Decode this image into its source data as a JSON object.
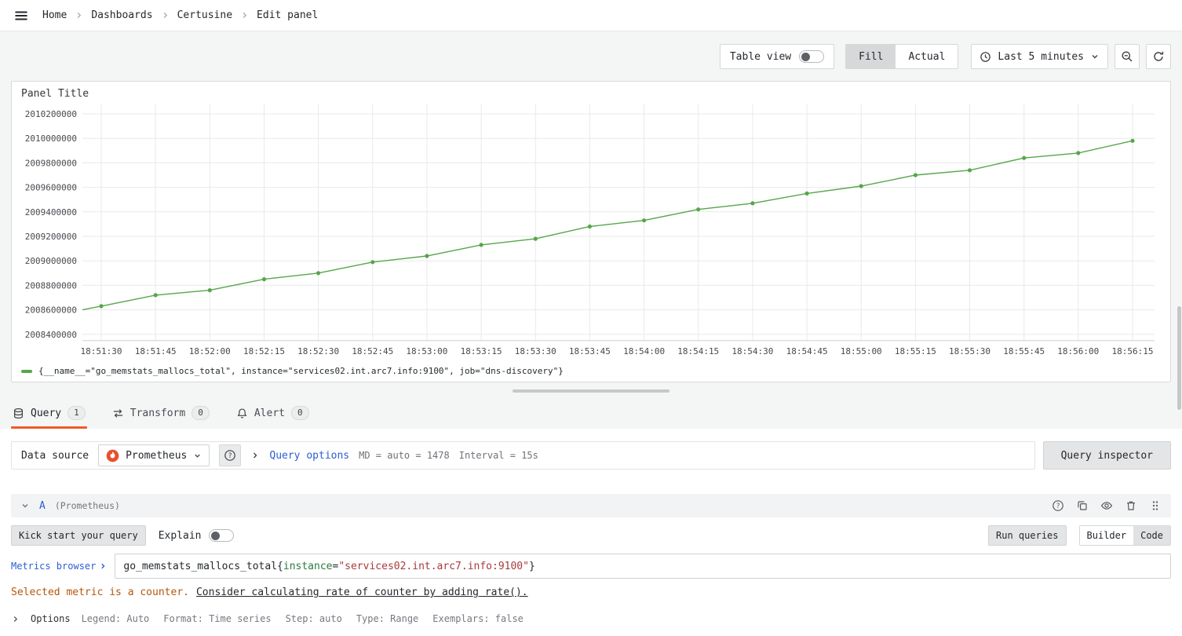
{
  "breadcrumb": {
    "items": [
      "Home",
      "Dashboards",
      "Certusine",
      "Edit panel"
    ]
  },
  "toolbar": {
    "table_view_label": "Table view",
    "fill_label": "Fill",
    "actual_label": "Actual",
    "time_range_label": "Last 5 minutes"
  },
  "panel": {
    "title": "Panel Title",
    "legend": "{__name__=\"go_memstats_mallocs_total\", instance=\"services02.int.arc7.info:9100\", job=\"dns-discovery\"}"
  },
  "chart_data": {
    "type": "line",
    "title": "Panel Title",
    "x": [
      "18:51:30",
      "18:51:45",
      "18:52:00",
      "18:52:15",
      "18:52:30",
      "18:52:45",
      "18:53:00",
      "18:53:15",
      "18:53:30",
      "18:53:45",
      "18:54:00",
      "18:54:15",
      "18:54:30",
      "18:54:45",
      "18:55:00",
      "18:55:15",
      "18:55:30",
      "18:55:45",
      "18:56:00",
      "18:56:15"
    ],
    "series": [
      {
        "name": "{__name__=\"go_memstats_mallocs_total\", instance=\"services02.int.arc7.info:9100\", job=\"dns-discovery\"}",
        "color": "#56a64b",
        "values": [
          2008630000,
          2008720000,
          2008760000,
          2008850000,
          2008900000,
          2008990000,
          2009040000,
          2009130000,
          2009180000,
          2009280000,
          2009330000,
          2009420000,
          2009470000,
          2009550000,
          2009610000,
          2009700000,
          2009740000,
          2009840000,
          2009880000,
          2009980000
        ]
      }
    ],
    "edge_start_value": 2008600000,
    "yticks": [
      2010200000,
      2010000000,
      2009800000,
      2009600000,
      2009400000,
      2009200000,
      2009000000,
      2008800000,
      2008600000,
      2008400000
    ],
    "ylim": [
      2008400000,
      2010200000
    ],
    "xlabel": "",
    "ylabel": "",
    "grid": true,
    "legend_position": "bottom"
  },
  "tabs": [
    {
      "label": "Query",
      "count": "1"
    },
    {
      "label": "Transform",
      "count": "0"
    },
    {
      "label": "Alert",
      "count": "0"
    }
  ],
  "query_editor": {
    "datasource_label": "Data source",
    "datasource_name": "Prometheus",
    "query_options_label": "Query options",
    "max_data_points": "MD = auto = 1478",
    "interval": "Interval = 15s",
    "query_inspector_label": "Query inspector",
    "row_ref_id": "A",
    "row_datasource_hint": "(Prometheus)",
    "kick_start_label": "Kick start your query",
    "explain_label": "Explain",
    "run_queries_label": "Run queries",
    "builder_label": "Builder",
    "code_label": "Code",
    "metrics_browser_label": "Metrics browser",
    "expression_parts": [
      {
        "text": "go_memstats_mallocs_total{",
        "type": "default"
      },
      {
        "text": "instance",
        "type": "label"
      },
      {
        "text": "=",
        "type": "default"
      },
      {
        "text": "\"services02.int.arc7.info:9100\"",
        "type": "string"
      },
      {
        "text": "}",
        "type": "default"
      }
    ],
    "warning_text": "Selected metric is a counter.",
    "warning_link_text": "Consider calculating rate of counter by adding rate().",
    "options_label": "Options",
    "options_summary": [
      "Legend: Auto",
      "Format: Time series",
      "Step: auto",
      "Type: Range",
      "Exemplars: false"
    ]
  },
  "colors": {
    "accent_orange": "#f05a28",
    "series_green": "#56a64b",
    "link_blue": "#2d5cd3",
    "warning_orange": "#b5560d",
    "string_red": "#a93a3a",
    "label_green": "#2b7a3f",
    "prometheus_orange": "#e6522c"
  }
}
